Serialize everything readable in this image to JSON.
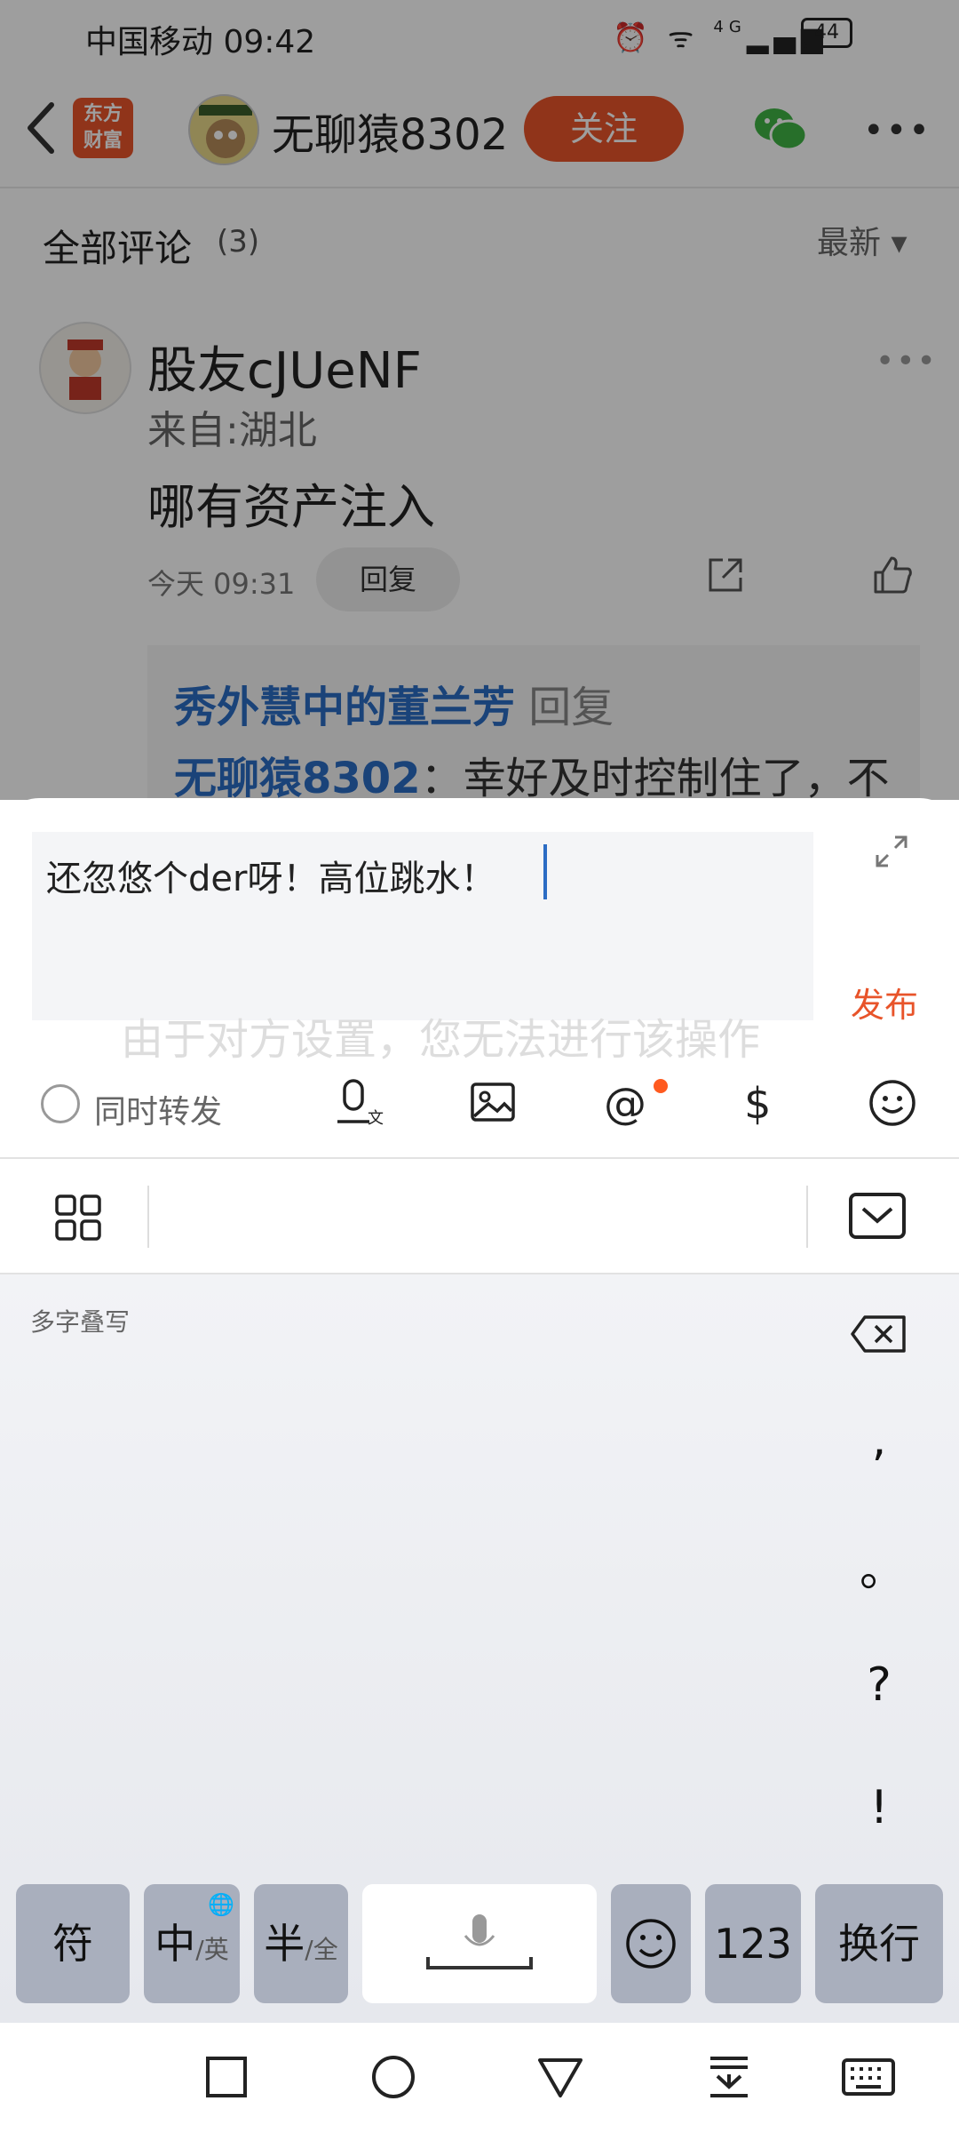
{
  "status_bar": {
    "carrier_time": "中国移动 09:42",
    "network": "4G",
    "battery": "44"
  },
  "app_bar": {
    "logo_text_line1": "东方",
    "logo_text_line2": "财富",
    "username": "无聊猿8302",
    "follow_label": "关注"
  },
  "comments": {
    "title": "全部评论",
    "count": "(3)",
    "sort_label": "最新 ▾",
    "item": {
      "author": "股友cJUeNF",
      "from": "来自:湖北",
      "text": "哪有资产注入",
      "time": "今天 09:31",
      "reply_label": "回复",
      "subreply": {
        "line1_name": "秀外慧中的董兰芳",
        "line1_action": "回复",
        "line2_name": "无聊猿8302",
        "line2_text": "：幸好及时控制住了，不"
      }
    }
  },
  "compose": {
    "input_value": "还忽悠个der呀！高位跳水！",
    "ghost_hint": "由于对方设置，您无法进行该操作",
    "publish_label": "发布",
    "repost_label": "同时转发"
  },
  "keyboard": {
    "multi_char_label": "多字叠写",
    "punctuation": [
      ",",
      "。",
      "?",
      "!"
    ],
    "keys": {
      "symbols": "符",
      "zh": "中",
      "zh_sub": "/英",
      "half": "半",
      "half_sub": "/全",
      "num": "123",
      "enter": "换行"
    }
  }
}
